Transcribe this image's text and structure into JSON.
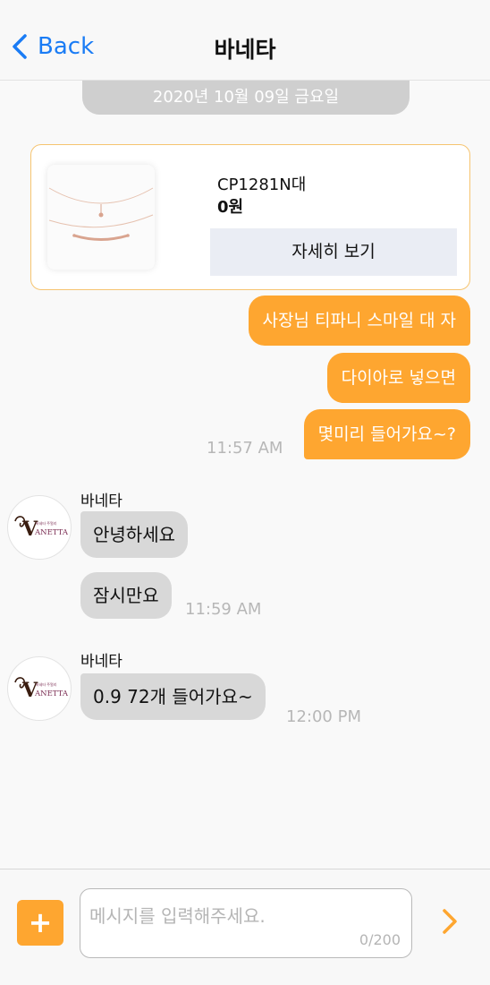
{
  "header": {
    "back_label": "Back",
    "title": "바네타"
  },
  "date_divider": "2020년 10월 09일 금요일",
  "product": {
    "name": "CP1281N대",
    "price": "0원",
    "detail_button": "자세히 보기"
  },
  "outgoing": {
    "messages": [
      "사장님 티파니 스마일 대 자",
      "다이아로 넣으면",
      "몇미리 들어가요~?"
    ],
    "time": "11:57 AM"
  },
  "incoming_1": {
    "sender": "바네타",
    "messages": [
      "안녕하세요",
      "잠시만요"
    ],
    "time": "11:59 AM"
  },
  "incoming_2": {
    "sender": "바네타",
    "message": "0.9  72개 들어가요~",
    "time": "12:00 PM"
  },
  "avatar_logo": {
    "letter": "V",
    "brand": "ANETTA",
    "subtitle": "바네타 주얼리"
  },
  "composer": {
    "plus_label": "+",
    "placeholder": "메시지를 입력해주세요.",
    "counter": "0/200"
  },
  "colors": {
    "accent": "#fea630",
    "link": "#1a7cf5",
    "incoming_bubble": "#d8d8d8"
  }
}
